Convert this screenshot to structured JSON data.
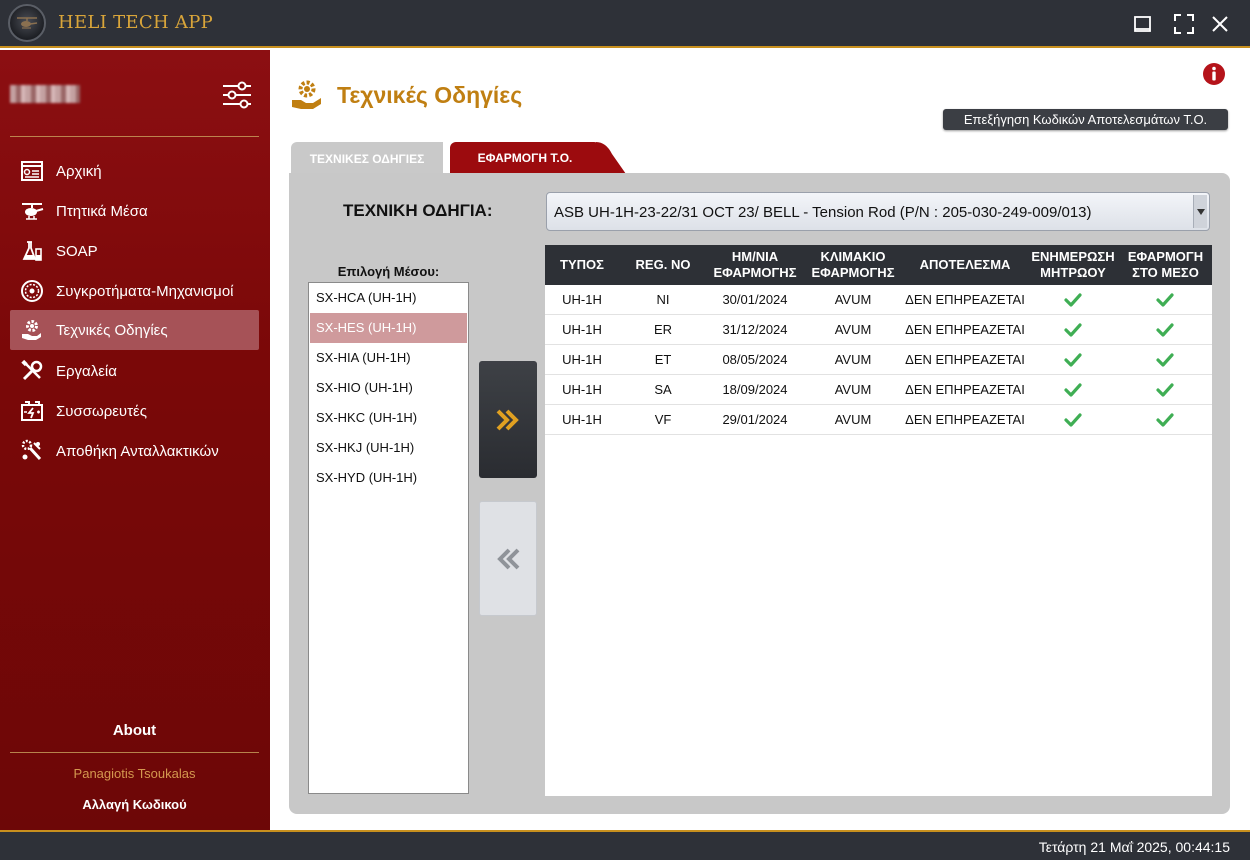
{
  "app": {
    "title": "HELI TECH APP",
    "logo_icon": "helicopter-logo"
  },
  "window_controls": [
    "maximize-icon",
    "fullscreen-icon",
    "close-icon"
  ],
  "sidebar": {
    "user_name_blurred": true,
    "settings_icon": "sliders-icon",
    "items": [
      {
        "label": "Αρχική",
        "icon": "dashboard-icon"
      },
      {
        "label": "Πτητικά Μέσα",
        "icon": "helicopter-icon"
      },
      {
        "label": "SOAP",
        "icon": "lab-flask-icon"
      },
      {
        "label": "Συγκροτήματα-Μηχανισμοί",
        "icon": "engine-icon"
      },
      {
        "label": "Τεχνικές Οδηγίες",
        "icon": "gear-hand-icon",
        "active": true
      },
      {
        "label": "Εργαλεία",
        "icon": "tools-icon"
      },
      {
        "label": "Συσσωρευτές",
        "icon": "battery-icon"
      },
      {
        "label": "Αποθήκη Ανταλλακτικών",
        "icon": "parts-icon"
      }
    ],
    "about": "About",
    "author": "Panagiotis Tsoukalas",
    "change_password": "Αλλαγή Κωδικού"
  },
  "page": {
    "title": "Τεχνικές Οδηγίες",
    "explain_button": "Επεξήγηση Κωδικών Αποτελεσμάτων Τ.Ο.",
    "tabs": [
      {
        "label": "ΤΕΧΝΙΚΕΣ ΟΔΗΓΙΕΣ",
        "active": false
      },
      {
        "label": "ΕΦΑΡΜΟΓΗ Τ.Ο.",
        "active": true
      }
    ],
    "technical_directive_label": "ΤΕΧΝΙΚΗ ΟΔΗΓΙΑ:",
    "technical_directive_value": "ASB UH-1H-23-22/31 OCT 23/ BELL - Tension Rod (P/N : 205-030-249-009/013)",
    "aircraft_list_label": "Επιλογή Μέσου:",
    "aircraft_list": [
      {
        "label": "SX-HCA (UH-1H)",
        "selected": false
      },
      {
        "label": "SX-HES (UH-1H)",
        "selected": true
      },
      {
        "label": "SX-HIA (UH-1H)",
        "selected": false
      },
      {
        "label": "SX-HIO (UH-1H)",
        "selected": false
      },
      {
        "label": "SX-HKC (UH-1H)",
        "selected": false
      },
      {
        "label": "SX-HKJ (UH-1H)",
        "selected": false
      },
      {
        "label": "SX-HYD (UH-1H)",
        "selected": false
      }
    ],
    "move_right_icon": "double-chevron-right-icon",
    "move_left_icon": "double-chevron-left-icon",
    "table": {
      "headers": [
        "ΤΥΠΟΣ",
        "REG. NO",
        "ΗΜ/ΝΙΑ ΕΦΑΡΜΟΓΗΣ",
        "ΚΛΙΜΑΚΙΟ ΕΦΑΡΜΟΓΗΣ",
        "ΑΠΟΤΕΛΕΣΜΑ",
        "ΕΝΗΜΕΡΩΣΗ ΜΗΤΡΩΟΥ",
        "ΕΦΑΡΜΟΓΗ ΣΤΟ ΜΕΣΟ"
      ],
      "rows": [
        {
          "type": "UH-1H",
          "reg": "NI",
          "date": "30/01/2024",
          "unit": "AVUM",
          "result": "ΔΕΝ ΕΠΗΡΕΑΖΕΤΑΙ",
          "registry": true,
          "applied": true
        },
        {
          "type": "UH-1H",
          "reg": "ER",
          "date": "31/12/2024",
          "unit": "AVUM",
          "result": "ΔΕΝ ΕΠΗΡΕΑΖΕΤΑΙ",
          "registry": true,
          "applied": true
        },
        {
          "type": "UH-1H",
          "reg": "ET",
          "date": "08/05/2024",
          "unit": "AVUM",
          "result": "ΔΕΝ ΕΠΗΡΕΑΖΕΤΑΙ",
          "registry": true,
          "applied": true
        },
        {
          "type": "UH-1H",
          "reg": "SA",
          "date": "18/09/2024",
          "unit": "AVUM",
          "result": "ΔΕΝ ΕΠΗΡΕΑΖΕΤΑΙ",
          "registry": true,
          "applied": true
        },
        {
          "type": "UH-1H",
          "reg": "VF",
          "date": "29/01/2024",
          "unit": "AVUM",
          "result": "ΔΕΝ ΕΠΗΡΕΑΖΕΤΑΙ",
          "registry": true,
          "applied": true
        }
      ]
    }
  },
  "status_bar": {
    "datetime": "Τετάρτη 21 Μαΐ 2025, 00:44:15"
  },
  "colors": {
    "accent_gold": "#c8901e",
    "sidebar_red": "#7a0808",
    "active_tab_red": "#9c0b0e",
    "check_green": "#3fae54",
    "dark_chrome": "#2e3138"
  }
}
